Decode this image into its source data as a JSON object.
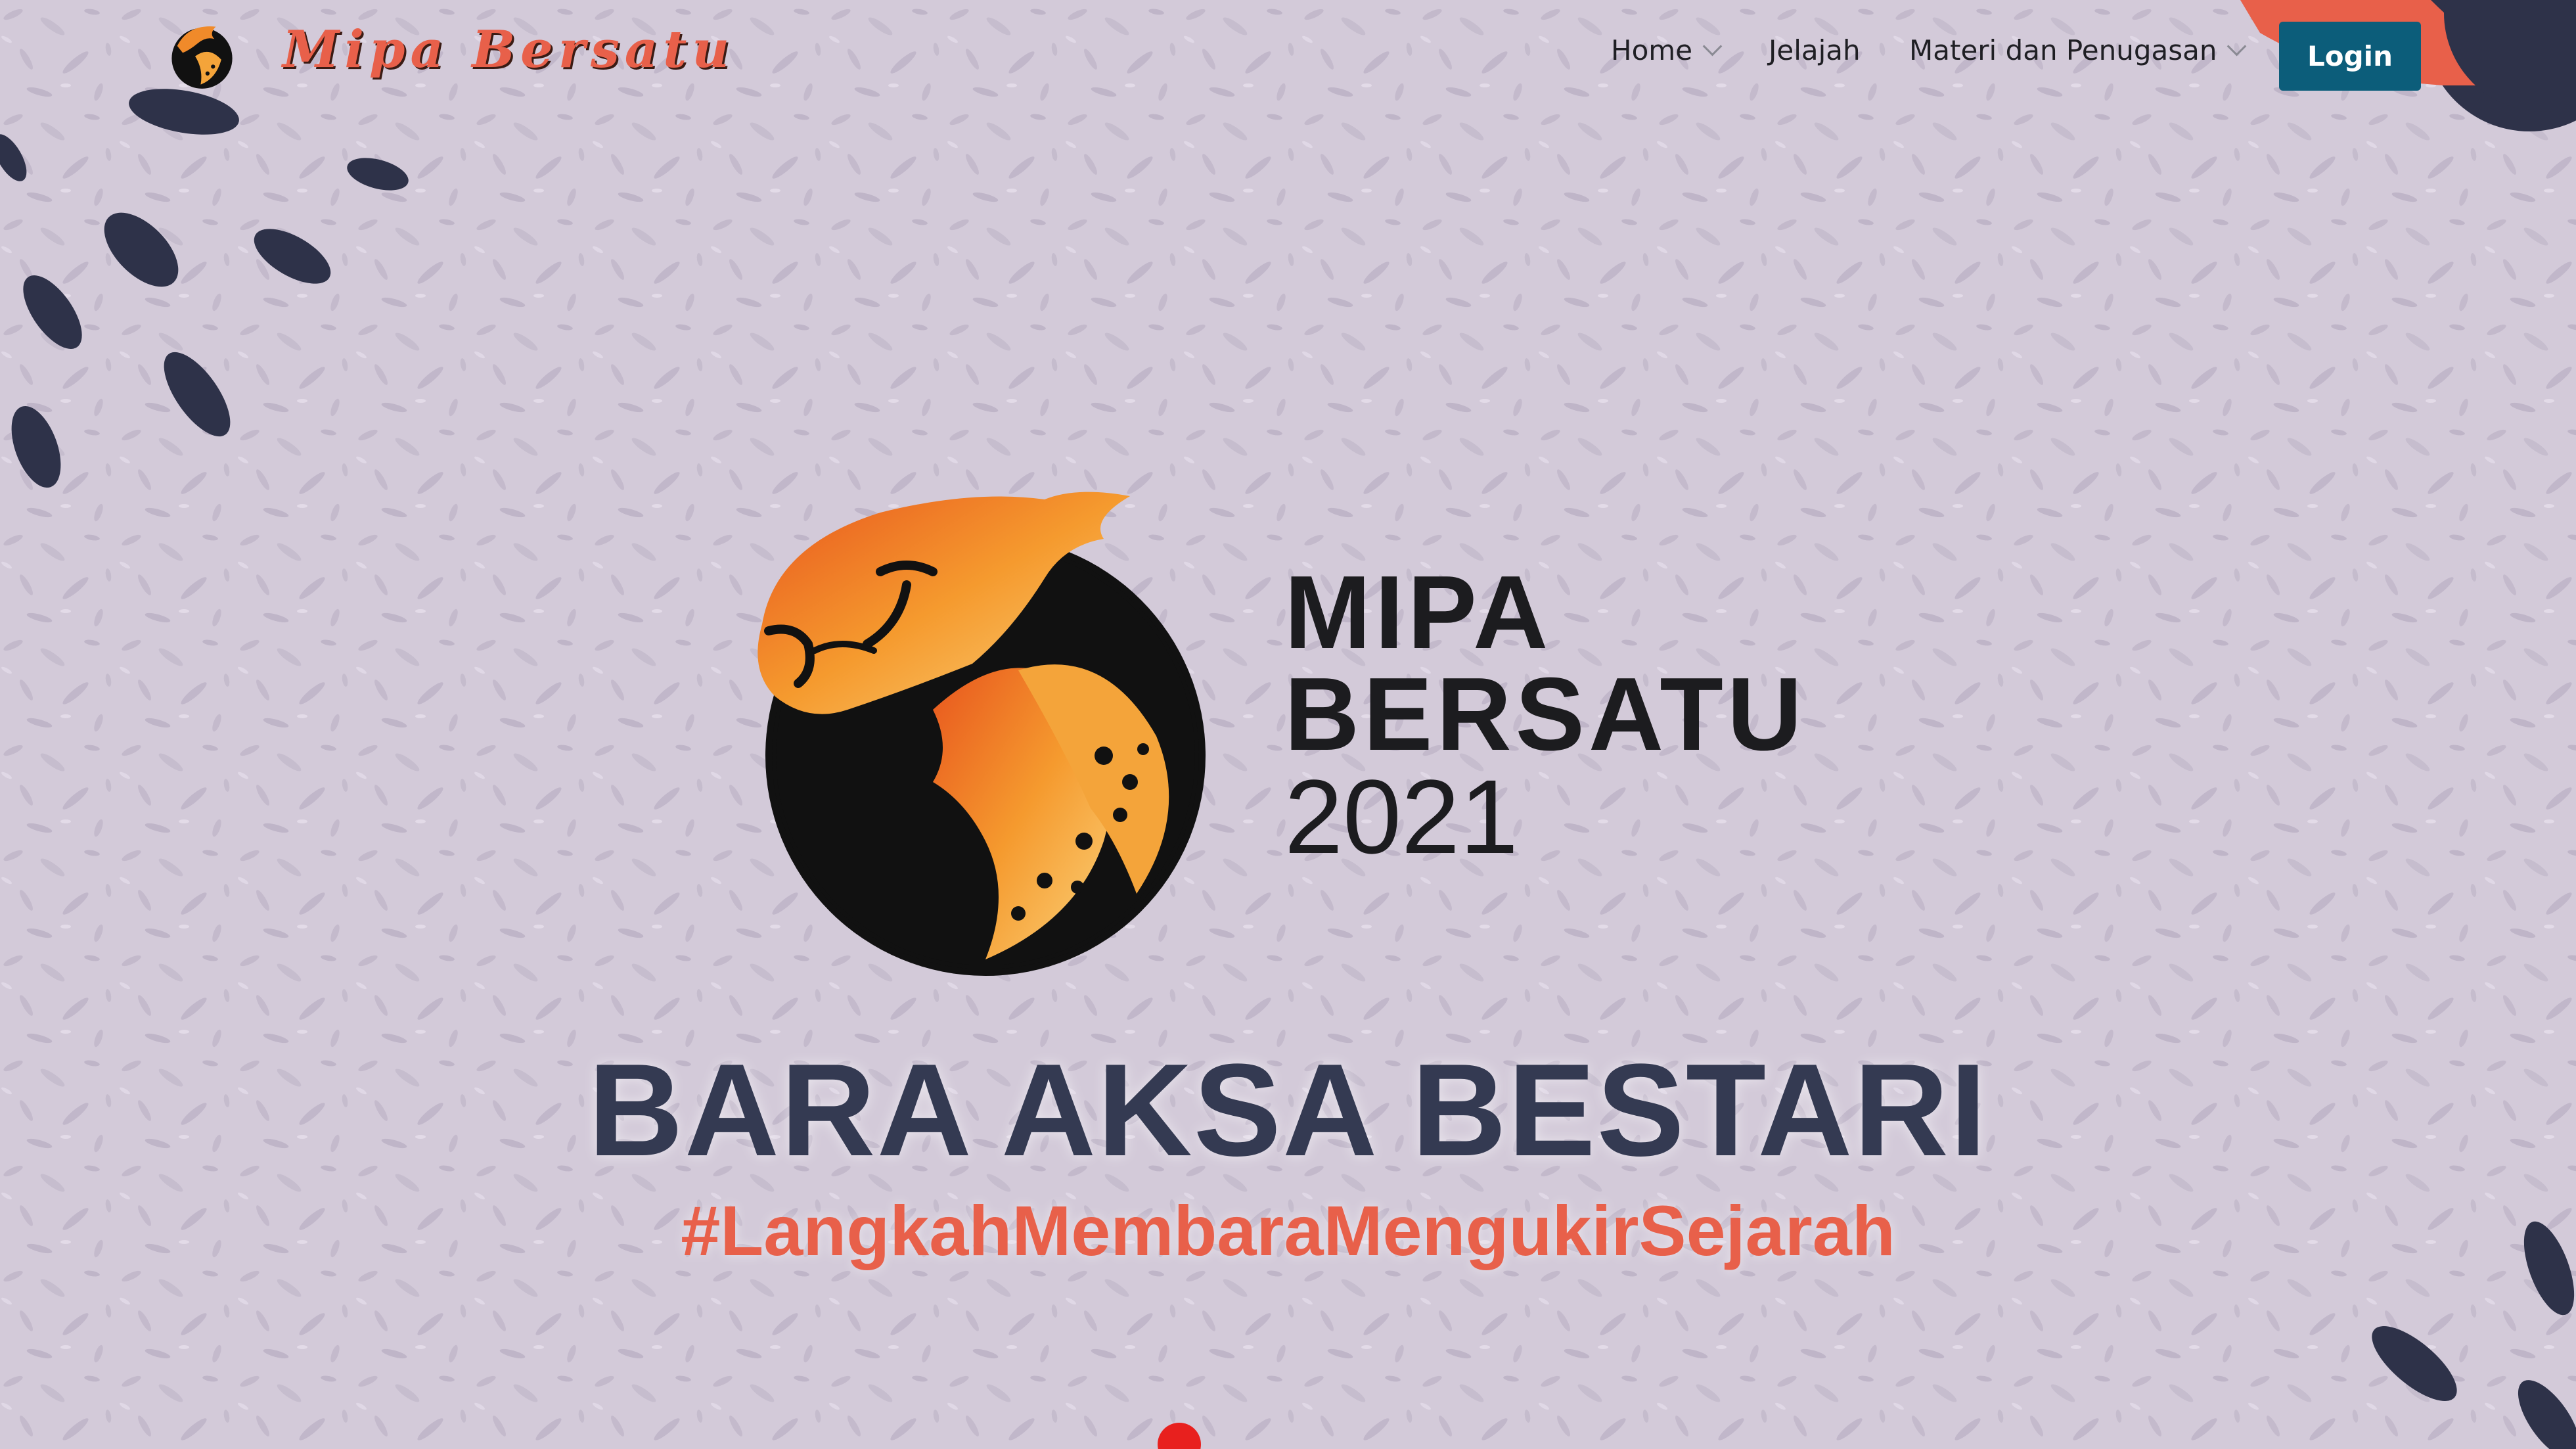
{
  "brand": {
    "name": "Mipa Bersatu",
    "logo_icon": "cheetah-logo-icon"
  },
  "nav": {
    "items": [
      {
        "label": "Home",
        "has_dropdown": true
      },
      {
        "label": "Jelajah",
        "has_dropdown": false
      },
      {
        "label": "Materi dan Penugasan",
        "has_dropdown": true
      }
    ],
    "login_label": "Login"
  },
  "hero": {
    "logo_line1": "MIPA",
    "logo_line2": "BERSATU",
    "logo_year": "2021",
    "title": "BARA AKSA BESTARI",
    "hashtag": "#LangkahMembaraMengukirSejarah",
    "emblem_icon": "cheetah-emblem-icon"
  },
  "colors": {
    "background": "#d3cad9",
    "accent": "#e8604a",
    "login_button": "#0c5d7a",
    "title_dark": "#343a52",
    "deco_dark": "#2e3249"
  }
}
